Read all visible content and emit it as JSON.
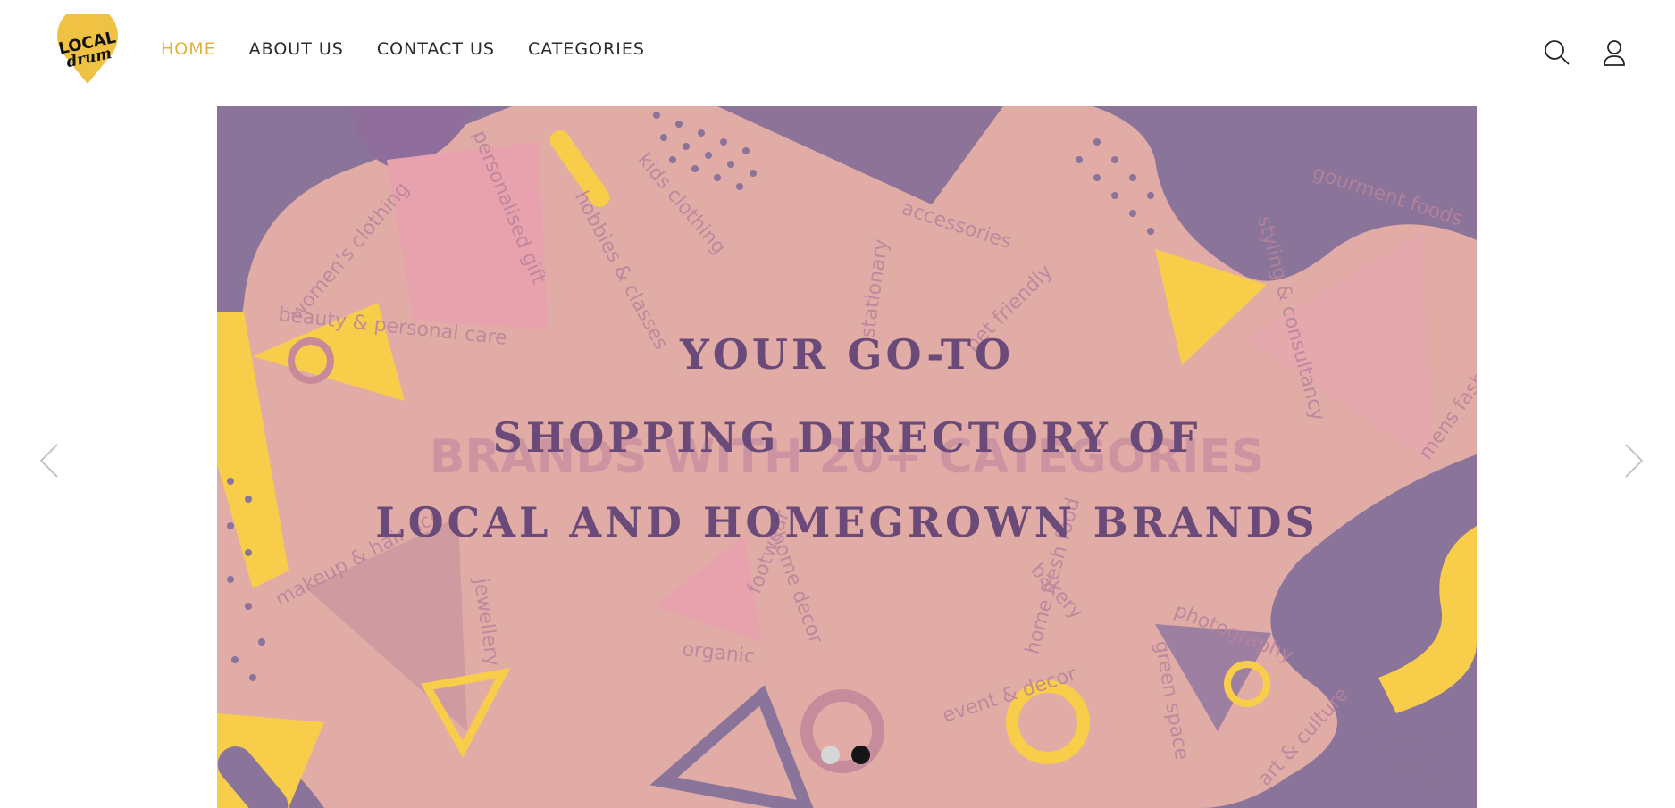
{
  "logo": {
    "line1": "LOCAL",
    "line2": "drum",
    "color": "#efc244"
  },
  "nav": [
    {
      "label": "HOME",
      "active": true
    },
    {
      "label": "ABOUT US",
      "active": false
    },
    {
      "label": "CONTACT US",
      "active": false
    },
    {
      "label": "CATEGORIES",
      "active": false
    }
  ],
  "header_icons": [
    "search-icon",
    "account-icon"
  ],
  "slider": {
    "headline": [
      "YOUR GO-TO",
      "SHOPPING DIRECTORY OF",
      "LOCAL AND HOMEGROWN BRANDS"
    ],
    "background_text": "BRANDS WITH 20+ CATEGORIES",
    "category_words": [
      "women's clothing",
      "personalised gift",
      "kids clothing",
      "hobbies & classes",
      "accessories",
      "stationary",
      "pet friendly",
      "gourment foods",
      "styling & consultancy",
      "mens fashion",
      "beauty & personal care",
      "makeup & hair acc",
      "jewellery",
      "footwear",
      "home decor",
      "organic",
      "home fresh food",
      "bakery",
      "event & decor",
      "photography",
      "green space",
      "art & culture"
    ],
    "slide_count": 2,
    "active_slide": 2,
    "colors": {
      "pink": "#e2aca6",
      "purple": "#8a7499",
      "yellow": "#f8cd4a",
      "headline": "#6a4a78"
    }
  }
}
